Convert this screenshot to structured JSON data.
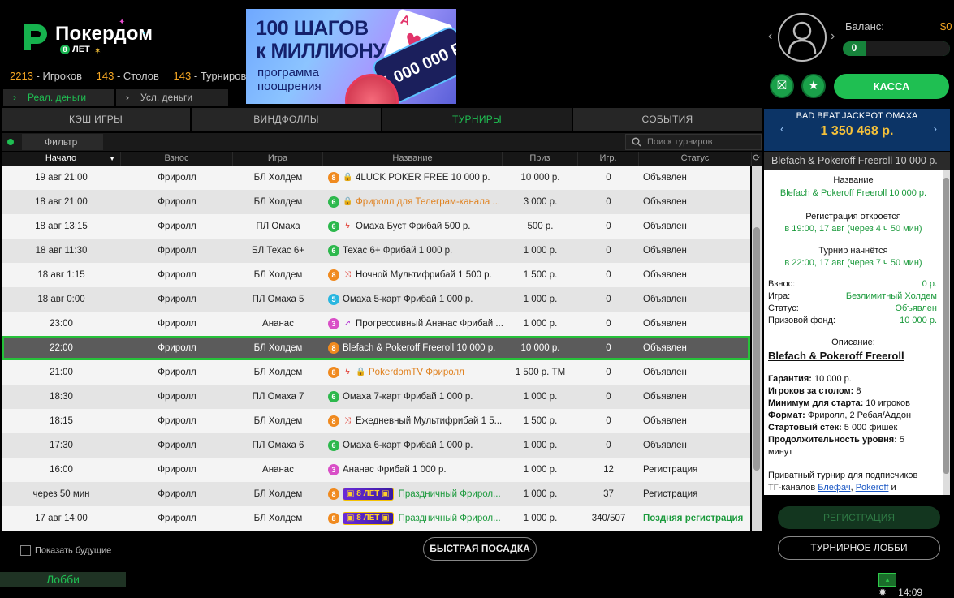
{
  "header": {
    "logo_text": "Покердом",
    "logo_sub": "ЛЕТ",
    "logo_badge": "8",
    "stats": [
      {
        "num": "2213",
        "label": "Игроков"
      },
      {
        "num": "143",
        "label": "Столов"
      },
      {
        "num": "143",
        "label": "Турниров"
      }
    ],
    "banner": {
      "line1": "100 ШАГОВ",
      "line2": "к МИЛЛИОНУ",
      "line3": "программа",
      "line4": "поощрения",
      "card": "A",
      "million": "1 000 000 Р"
    },
    "balance_label": "Баланс:",
    "balance_value": "$0",
    "progress_value": "0",
    "kassa_label": "КАССА"
  },
  "money_tabs": [
    {
      "label": "Реал. деньги"
    },
    {
      "label": "Усл. деньги"
    }
  ],
  "category_tabs": [
    "КЭШ ИГРЫ",
    "ВИНДФОЛЛЫ",
    "ТУРНИРЫ",
    "СОБЫТИЯ"
  ],
  "filter": {
    "label": "Фильтр",
    "search_placeholder": "Поиск турниров"
  },
  "table": {
    "columns": [
      "Начало",
      "Взнос",
      "Игра",
      "Название",
      "Приз",
      "Игр.",
      "Статус"
    ],
    "rows": [
      {
        "start": "19 авг 21:00",
        "fee": "Фриролл",
        "game": "БЛ Холдем",
        "badge": "8",
        "icon": "lock",
        "name": "4LUCK POKER FREE 10 000 р.",
        "name_style": "",
        "prize": "10 000 р.",
        "players": "0",
        "status": "Объявлен"
      },
      {
        "start": "18 авг 21:00",
        "fee": "Фриролл",
        "game": "БЛ Холдем",
        "badge": "6",
        "icon": "lock",
        "name": "Фриролл для Телеграм-канала ...",
        "name_style": "orange",
        "prize": "3 000 р.",
        "players": "0",
        "status": "Объявлен"
      },
      {
        "start": "18 авг 13:15",
        "fee": "Фриролл",
        "game": "ПЛ Омаха",
        "badge": "6",
        "icon": "bolt",
        "name": "Омаха Буст Фрибай 500 р.",
        "name_style": "",
        "prize": "500 р.",
        "players": "0",
        "status": "Объявлен"
      },
      {
        "start": "18 авг 11:30",
        "fee": "Фриролл",
        "game": "БЛ Техас 6+",
        "badge": "6",
        "icon": "",
        "name": "Техас 6+ Фрибай 1 000 р.",
        "name_style": "",
        "prize": "1 000 р.",
        "players": "0",
        "status": "Объявлен"
      },
      {
        "start": "18 авг 1:15",
        "fee": "Фриролл",
        "game": "БЛ Холдем",
        "badge": "8",
        "icon": "shuffle",
        "name": "Ночной Мультифрибай 1 500 р.",
        "name_style": "",
        "prize": "1 500 р.",
        "players": "0",
        "status": "Объявлен"
      },
      {
        "start": "18 авг 0:00",
        "fee": "Фриролл",
        "game": "ПЛ Омаха 5",
        "badge": "5",
        "icon": "",
        "name": "Омаха 5-карт Фрибай 1 000 р.",
        "name_style": "",
        "prize": "1 000 р.",
        "players": "0",
        "status": "Объявлен"
      },
      {
        "start": "23:00",
        "fee": "Фриролл",
        "game": "Ананас",
        "badge": "3",
        "icon": "up",
        "name": "Прогрессивный Ананас Фрибай ...",
        "name_style": "",
        "prize": "1 000 р.",
        "players": "0",
        "status": "Объявлен"
      },
      {
        "start": "22:00",
        "fee": "Фриролл",
        "game": "БЛ Холдем",
        "badge": "8",
        "icon": "",
        "name": "Blefach & Pokeroff Freeroll 10 000 р.",
        "name_style": "",
        "prize": "10 000 р.",
        "players": "0",
        "status": "Объявлен",
        "selected": true
      },
      {
        "start": "21:00",
        "fee": "Фриролл",
        "game": "БЛ Холдем",
        "badge": "8",
        "icon": "bolt-lock",
        "name": "PokerdomTV Фриролл",
        "name_style": "orange",
        "prize": "1 500 р. ТМ",
        "players": "0",
        "status": "Объявлен"
      },
      {
        "start": "18:30",
        "fee": "Фриролл",
        "game": "ПЛ Омаха 7",
        "badge": "6",
        "icon": "",
        "name": "Омаха 7-карт Фрибай 1 000 р.",
        "name_style": "",
        "prize": "1 000 р.",
        "players": "0",
        "status": "Объявлен"
      },
      {
        "start": "18:15",
        "fee": "Фриролл",
        "game": "БЛ Холдем",
        "badge": "8",
        "icon": "shuffle",
        "name": "Ежедневный Мультифрибай 1 5...",
        "name_style": "",
        "prize": "1 500 р.",
        "players": "0",
        "status": "Объявлен"
      },
      {
        "start": "17:30",
        "fee": "Фриролл",
        "game": "ПЛ Омаха 6",
        "badge": "6",
        "icon": "",
        "name": "Омаха 6-карт Фрибай 1 000 р.",
        "name_style": "",
        "prize": "1 000 р.",
        "players": "0",
        "status": "Объявлен"
      },
      {
        "start": "16:00",
        "fee": "Фриролл",
        "game": "Ананас",
        "badge": "3",
        "icon": "",
        "name": "Ананас Фрибай 1 000 р.",
        "name_style": "",
        "prize": "1 000 р.",
        "players": "12",
        "status": "Регистрация"
      },
      {
        "start": "через 50 мин",
        "fee": "Фриролл",
        "game": "БЛ Холдем",
        "badge": "8",
        "icon": "pill",
        "pill": "8 ЛЕТ",
        "name": "Праздничный Фрирол...",
        "name_style": "green",
        "prize": "1 000 р.",
        "players": "37",
        "status": "Регистрация"
      },
      {
        "start": "17 авг 14:00",
        "fee": "Фриролл",
        "game": "БЛ Холдем",
        "badge": "8",
        "icon": "pill",
        "pill": "8 ЛЕТ",
        "name": "Праздничный Фрирол...",
        "name_style": "green",
        "prize": "1 000 р.",
        "players": "340/507",
        "status": "Поздняя регистрация",
        "status_style": "green"
      }
    ]
  },
  "bottom": {
    "show_future": "Показать будущие",
    "quick_seat": "БЫСТРАЯ ПОСАДКА",
    "lobby": "Лобби",
    "time": "14:09"
  },
  "jackpot": {
    "title": "BAD BEAT JACKPOT ОМАХА",
    "value": "1 350 468 р."
  },
  "details": {
    "title": "Blefach & Pokeroff Freeroll 10 000 р.",
    "name_label": "Название",
    "name_value": "Blefach & Pokeroff Freeroll 10 000 р.",
    "reg_label": "Регистрация откроется",
    "reg_value": "в 19:00, 17 авг (через 4 ч 50 мин)",
    "start_label": "Турнир начнётся",
    "start_value": "в 22:00, 17 авг (через 7 ч 50 мин)",
    "fee_label": "Взнос:",
    "fee_value": "0 р.",
    "game_label": "Игра:",
    "game_value": "Безлимитный Холдем",
    "status_label": "Статус:",
    "status_value": "Объявлен",
    "pool_label": "Призовой фонд:",
    "pool_value": "10 000 р.",
    "desc_label": "Описание:",
    "desc_title": "Blefach & Pokeroff Freeroll",
    "desc_lines": [
      {
        "b": "Гарантия:",
        "t": " 10 000 р."
      },
      {
        "b": "Игроков за столом:",
        "t": " 8"
      },
      {
        "b": "Минимум для старта:",
        "t": " 10 игроков"
      },
      {
        "b": "Формат:",
        "t": " Фриролл, 2 Ребая/Аддон"
      },
      {
        "b": "Стартовый стек:",
        "t": " 5 000 фишек"
      },
      {
        "b": "Продолжительность уровня:",
        "t": " 5"
      }
    ],
    "desc_cont": "минут",
    "private_text": "Приватный турнир для подписчиков",
    "tg_prefix": "ТГ-каналов ",
    "link1": "Блефач",
    "comma": ", ",
    "link2": "Pokeroff",
    "and_text": " и",
    "register_btn": "РЕГИСТРАЦИЯ",
    "lobby_btn": "ТУРНИРНОЕ ЛОББИ"
  },
  "colors": {
    "accent_green": "#1fbf52",
    "orange": "#f5a623",
    "jackpot_bg": "#0c3466",
    "selection_outline": "#27c13a"
  }
}
